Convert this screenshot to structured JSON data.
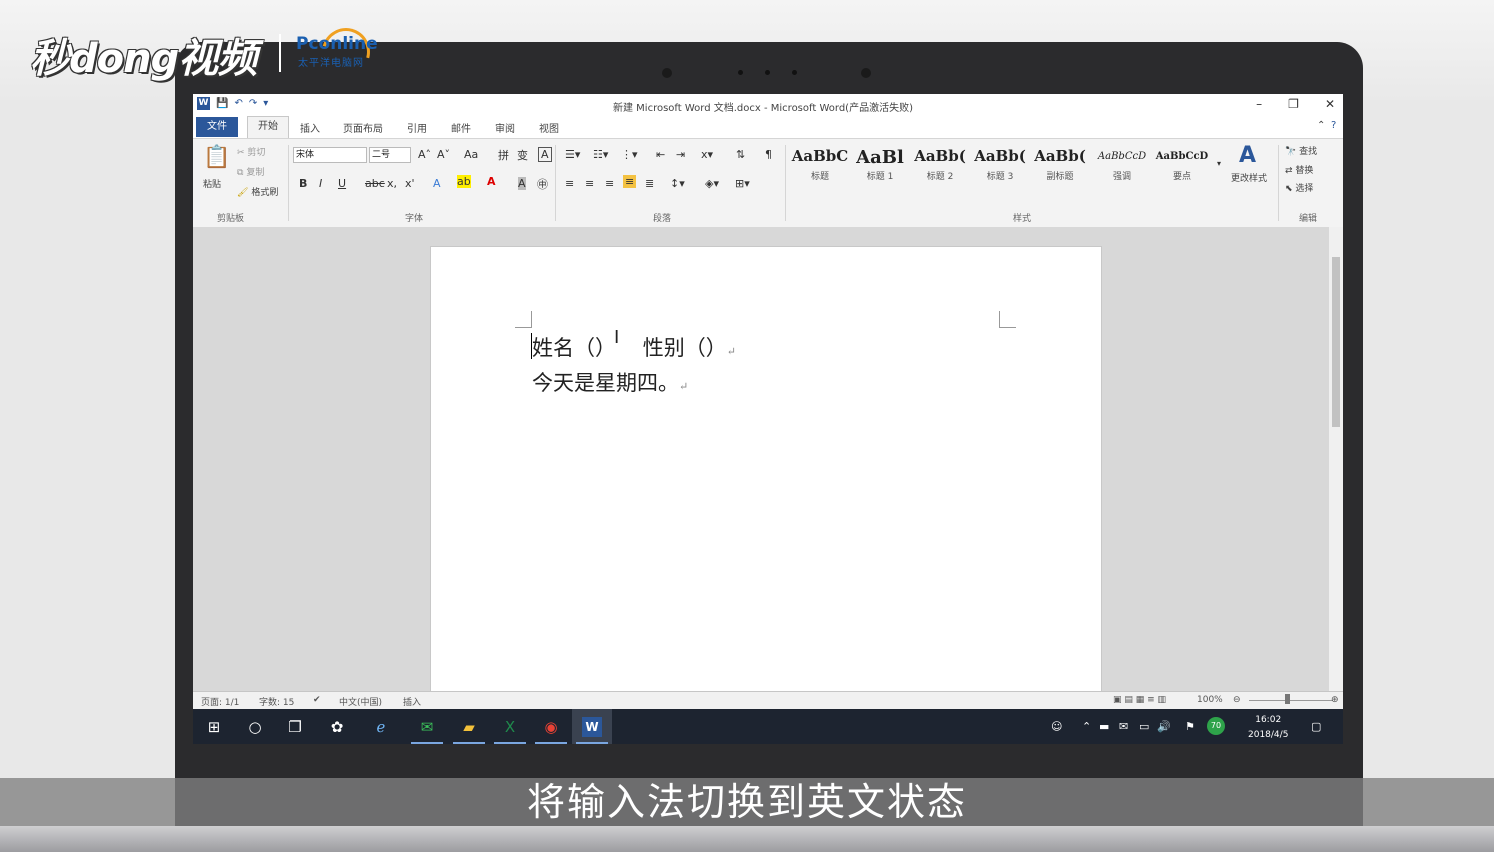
{
  "watermark": {
    "logo_text": "秒dong视频",
    "partner_logo": "Pconline",
    "partner_sub": "太平洋电脑网"
  },
  "window": {
    "title": "新建 Microsoft Word 文档.docx - Microsoft Word(产品激活失败)",
    "min_glyph": "–",
    "restore_glyph": "❐",
    "close_glyph": "✕"
  },
  "tabs": [
    {
      "label": "文件"
    },
    {
      "label": "开始"
    },
    {
      "label": "插入"
    },
    {
      "label": "页面布局"
    },
    {
      "label": "引用"
    },
    {
      "label": "邮件"
    },
    {
      "label": "审阅"
    },
    {
      "label": "视图"
    }
  ],
  "ribbon": {
    "clipboard": {
      "paste": "粘贴",
      "cut": "剪切",
      "copy": "复制",
      "format_painter": "格式刷",
      "group": "剪贴板"
    },
    "font": {
      "font_name": "宋体",
      "font_size": "二号",
      "group": "字体",
      "bold": "B",
      "italic": "I",
      "underline": "U",
      "strike": "abc",
      "sub": "x,",
      "sup": "x'",
      "grow": "A˄",
      "shrink": "A˅",
      "change_case": "Aa",
      "clear": "A",
      "color": "A",
      "highlight": "ab"
    },
    "paragraph": {
      "group": "段落"
    },
    "styles": {
      "group": "样式",
      "items": [
        {
          "sample": "AaBbC",
          "name": "标题"
        },
        {
          "sample": "AaBl",
          "name": "标题 1"
        },
        {
          "sample": "AaBb(",
          "name": "标题 2"
        },
        {
          "sample": "AaBb(",
          "name": "标题 3"
        },
        {
          "sample": "AaBb(",
          "name": "副标题"
        },
        {
          "sample": "AaBbCcD",
          "name": "强调"
        },
        {
          "sample": "AaBbCcD",
          "name": "要点"
        }
      ],
      "change_styles": "更改样式"
    },
    "editing": {
      "group": "编辑",
      "find": "查找",
      "replace": "替换",
      "select": "选择"
    }
  },
  "document": {
    "line1": "姓名（）    性别（）",
    "line2": "今天是星期四。",
    "pilcrow": "↵"
  },
  "status": {
    "page": "页面: 1/1",
    "words": "字数: 15",
    "lang": "中文(中国)",
    "mode": "插入",
    "zoom": "100%"
  },
  "taskbar": {
    "time": "16:02",
    "date": "2018/4/5",
    "badge": "70"
  },
  "caption": "将输入法切换到英文状态"
}
